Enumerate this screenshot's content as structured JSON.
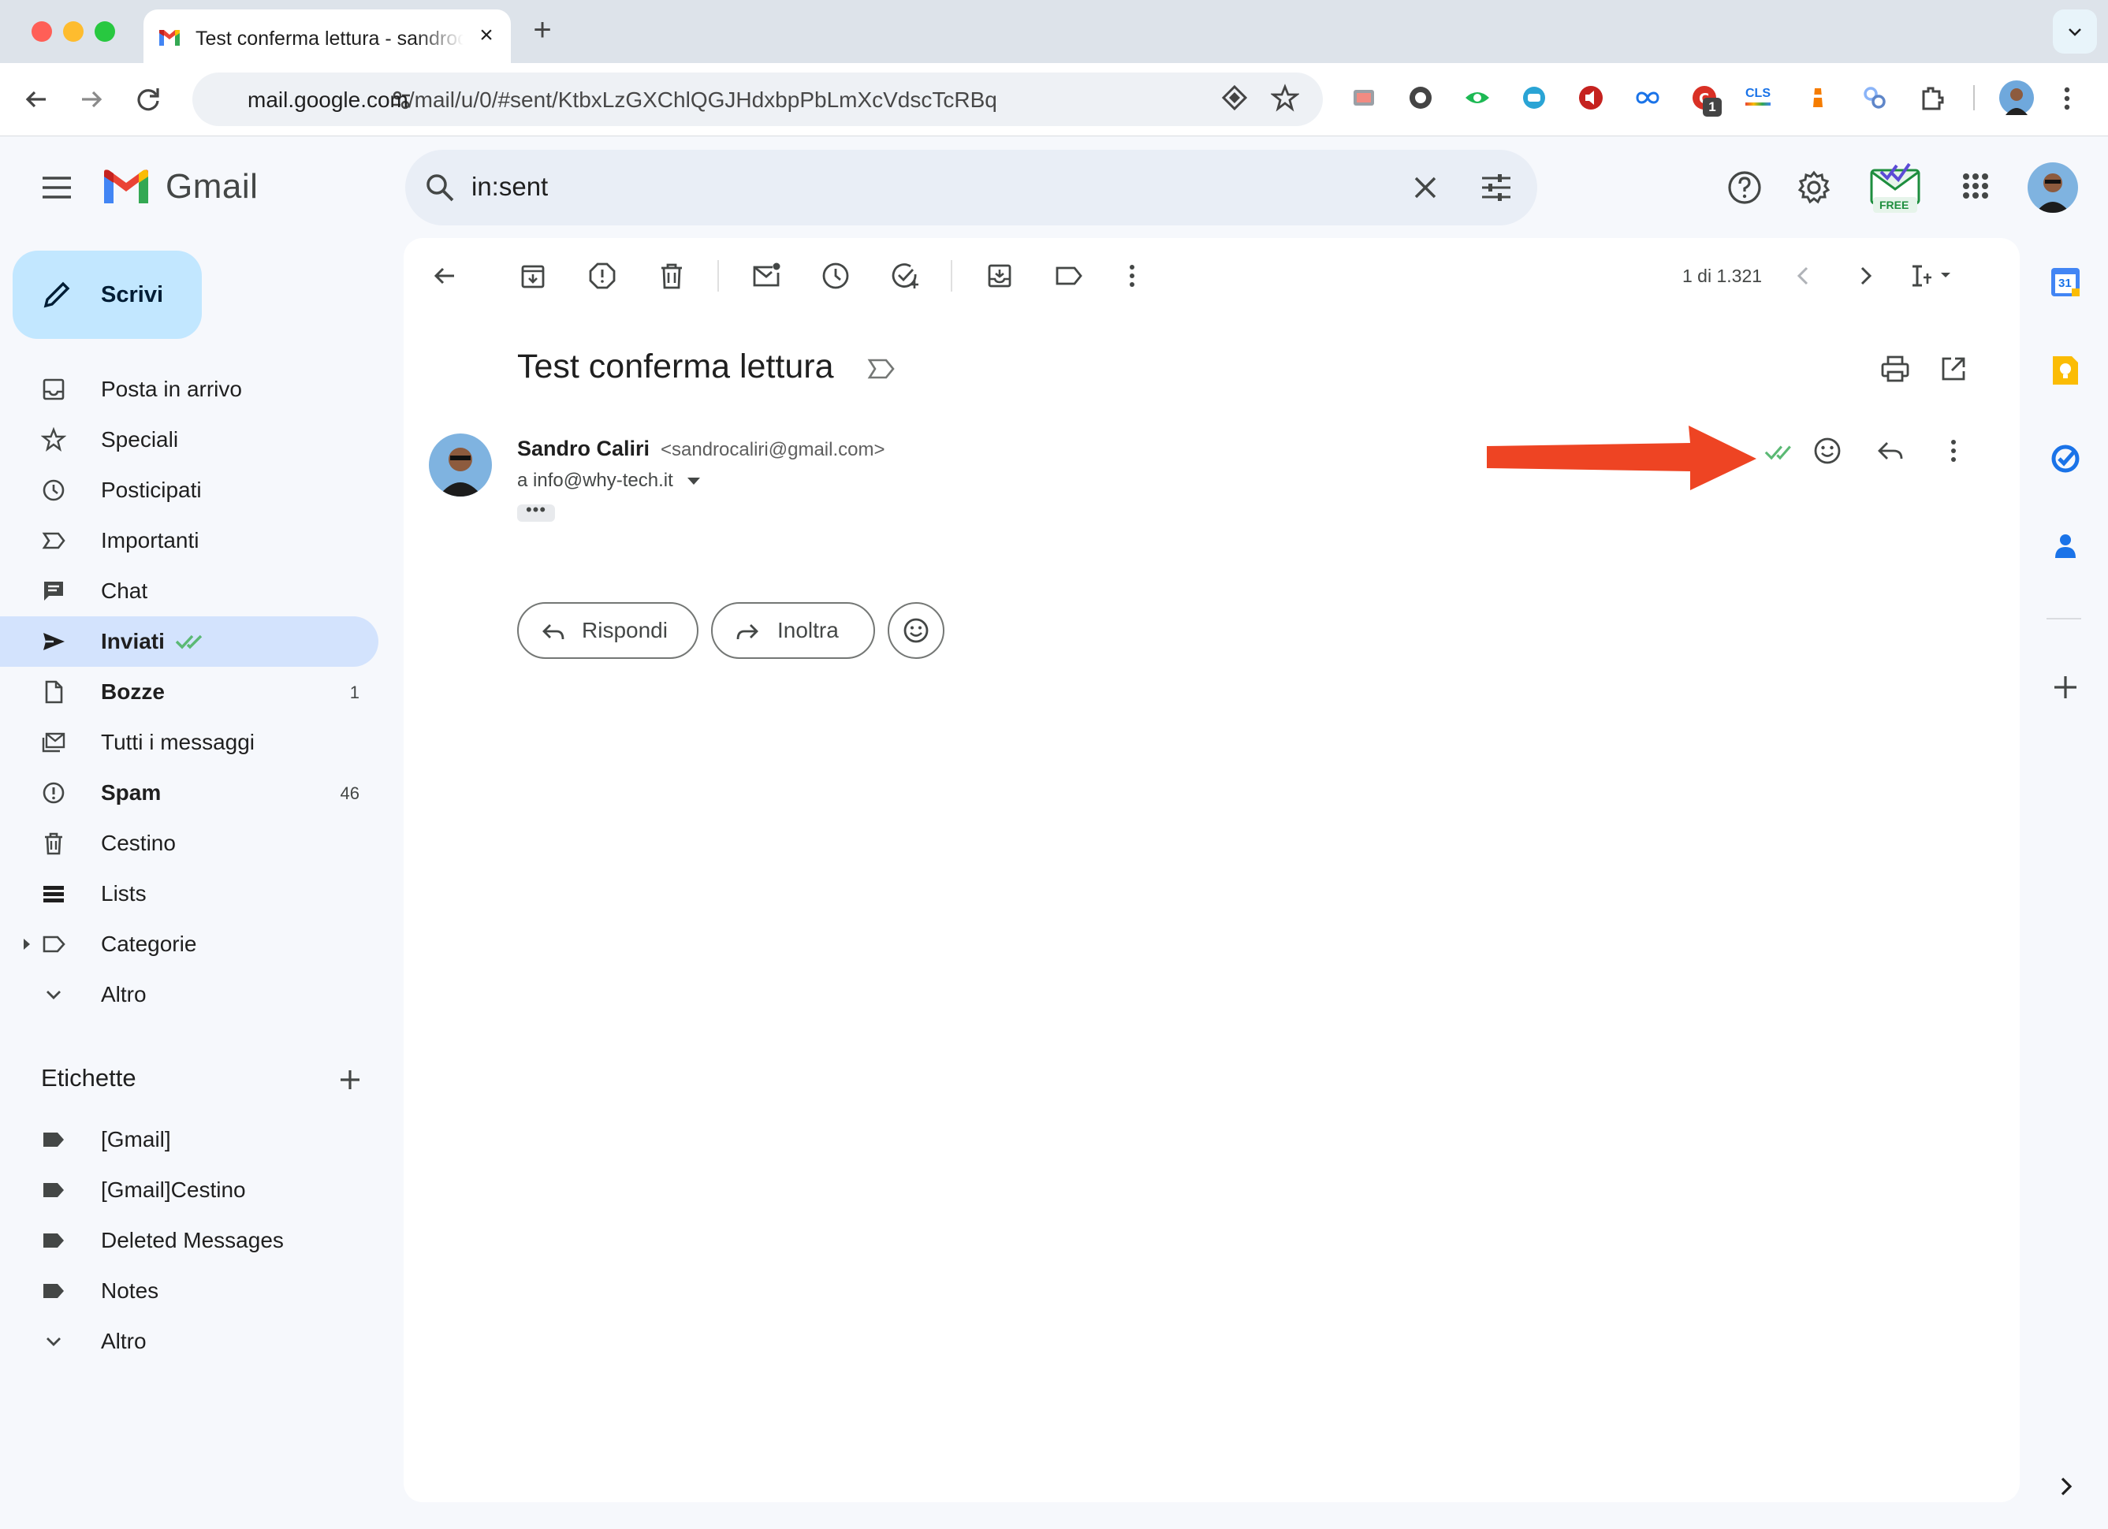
{
  "browser": {
    "tab_title": "Test conferma lettura - sandrocaliri@gmail.com - Gmail",
    "url_host": "mail.google.com",
    "url_path": "/mail/u/0/#sent/KtbxLzGXChlQGJHdxbpPbLmXcVdscTcRBq",
    "ext_badge": "1",
    "ext_cls": "CLS"
  },
  "gmail": {
    "logo_text": "Gmail",
    "search_value": "in:sent",
    "free_badge": "FREE",
    "compose_label": "Scrivi"
  },
  "nav": [
    {
      "label": "Posta in arrivo",
      "icon": "inbox-icon",
      "count": ""
    },
    {
      "label": "Speciali",
      "icon": "star-icon",
      "count": ""
    },
    {
      "label": "Posticipati",
      "icon": "clock-icon",
      "count": ""
    },
    {
      "label": "Importanti",
      "icon": "important-icon",
      "count": ""
    },
    {
      "label": "Chat",
      "icon": "chat-icon",
      "count": ""
    },
    {
      "label": "Inviati",
      "icon": "send-icon",
      "count": "",
      "active": true
    },
    {
      "label": "Bozze",
      "icon": "draft-icon",
      "count": "1"
    },
    {
      "label": "Tutti i messaggi",
      "icon": "all-mail-icon",
      "count": ""
    },
    {
      "label": "Spam",
      "icon": "spam-icon",
      "count": "46"
    },
    {
      "label": "Cestino",
      "icon": "trash-icon",
      "count": ""
    },
    {
      "label": "Lists",
      "icon": "lists-icon",
      "count": ""
    },
    {
      "label": "Categorie",
      "icon": "label-icon",
      "count": ""
    },
    {
      "label": "Altro",
      "icon": "chevron-down-icon",
      "count": ""
    }
  ],
  "labels": {
    "heading": "Etichette",
    "items": [
      "[Gmail]",
      "[Gmail]Cestino",
      "Deleted Messages",
      "Notes",
      "Altro"
    ]
  },
  "message": {
    "pager": "1 di 1.321",
    "subject": "Test conferma lettura",
    "sender_name": "Sandro Caliri",
    "sender_email": "<sandrocaliri@gmail.com>",
    "recipient": "a info@why-tech.it",
    "ellipsis": "•••",
    "reply_label": "Rispondi",
    "forward_label": "Inoltra"
  },
  "side_panel": {
    "calendar_day": "31"
  },
  "colors": {
    "accent": "#0b57d0",
    "active_nav": "#d3e3fd",
    "compose": "#c2e7ff",
    "read_check": "#34a853",
    "annotation_arrow": "#ee4423"
  }
}
